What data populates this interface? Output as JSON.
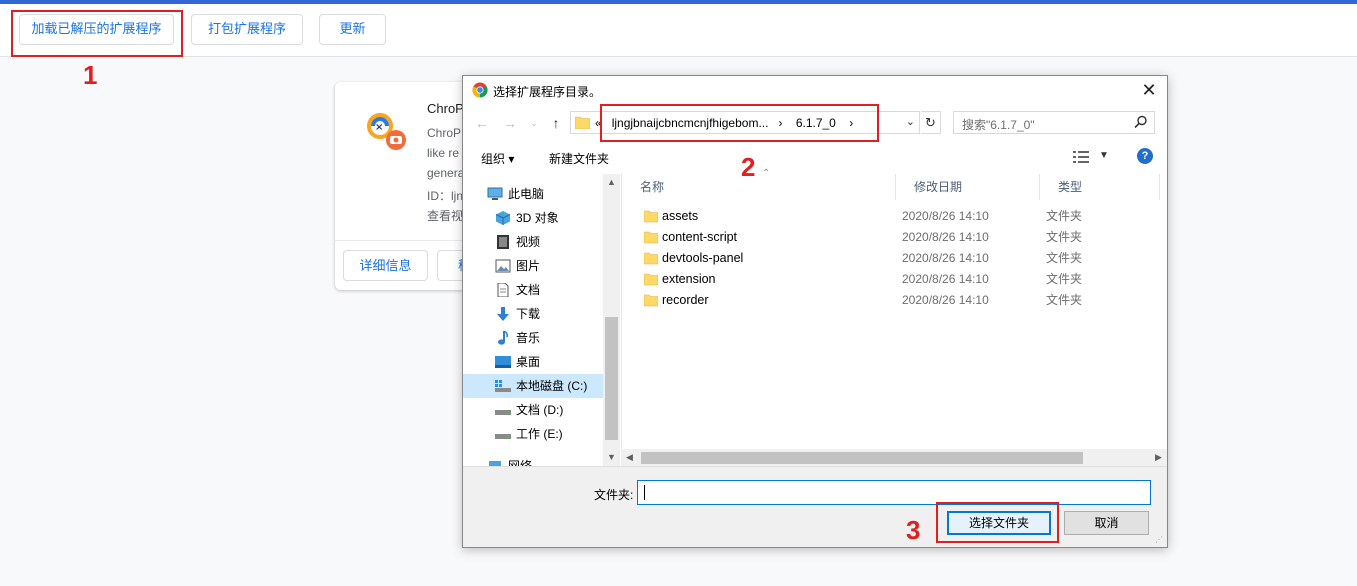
{
  "toolbar": {
    "load_unpacked": "加载已解压的扩展程序",
    "pack_extension": "打包扩展程序",
    "update": "更新"
  },
  "extension_card": {
    "name": "ChroP",
    "desc_line1": "ChroP",
    "desc_line2": "like re",
    "desc_line3": "genera",
    "id_text": "ID：ljn",
    "view_text": "查看视",
    "details_button": "详细信息",
    "remove_button": "移"
  },
  "annotations": {
    "one": "1",
    "two": "2",
    "three": "3"
  },
  "dialog": {
    "title": "选择扩展程序目录。",
    "close": "✕",
    "address": {
      "prefix": "«",
      "segment1": "ljngjbnaijcbncmcnjfhigebom...",
      "separator": "›",
      "segment2": "6.1.7_0",
      "separator2": "›"
    },
    "search_placeholder": "搜索\"6.1.7_0\"",
    "organize": "组织 ▾",
    "new_folder": "新建文件夹",
    "help": "?",
    "tree": [
      {
        "label": "此电脑",
        "icon": "computer-icon"
      },
      {
        "label": "3D 对象",
        "icon": "3d-objects-icon"
      },
      {
        "label": "视频",
        "icon": "video-icon"
      },
      {
        "label": "图片",
        "icon": "pictures-icon"
      },
      {
        "label": "文档",
        "icon": "documents-icon"
      },
      {
        "label": "下载",
        "icon": "download-icon"
      },
      {
        "label": "音乐",
        "icon": "music-icon"
      },
      {
        "label": "桌面",
        "icon": "desktop-icon"
      },
      {
        "label": "本地磁盘 (C:)",
        "icon": "drive-icon"
      },
      {
        "label": "文档 (D:)",
        "icon": "drive-icon"
      },
      {
        "label": "工作 (E:)",
        "icon": "drive-icon"
      },
      {
        "label": "网络",
        "icon": "network-icon"
      }
    ],
    "columns": {
      "name": "名称",
      "modified": "修改日期",
      "type": "类型"
    },
    "files": [
      {
        "name": "assets",
        "modified": "2020/8/26 14:10",
        "type": "文件夹"
      },
      {
        "name": "content-script",
        "modified": "2020/8/26 14:10",
        "type": "文件夹"
      },
      {
        "name": "devtools-panel",
        "modified": "2020/8/26 14:10",
        "type": "文件夹"
      },
      {
        "name": "extension",
        "modified": "2020/8/26 14:10",
        "type": "文件夹"
      },
      {
        "name": "recorder",
        "modified": "2020/8/26 14:10",
        "type": "文件夹"
      }
    ],
    "folder_label": "文件夹:",
    "folder_value": "",
    "select_folder": "选择文件夹",
    "cancel": "取消"
  },
  "colors": {
    "accent": "#1a73e8",
    "annotation_red": "#e02020",
    "selection": "#cce8ff",
    "folder_yellow": "#ffd866"
  }
}
